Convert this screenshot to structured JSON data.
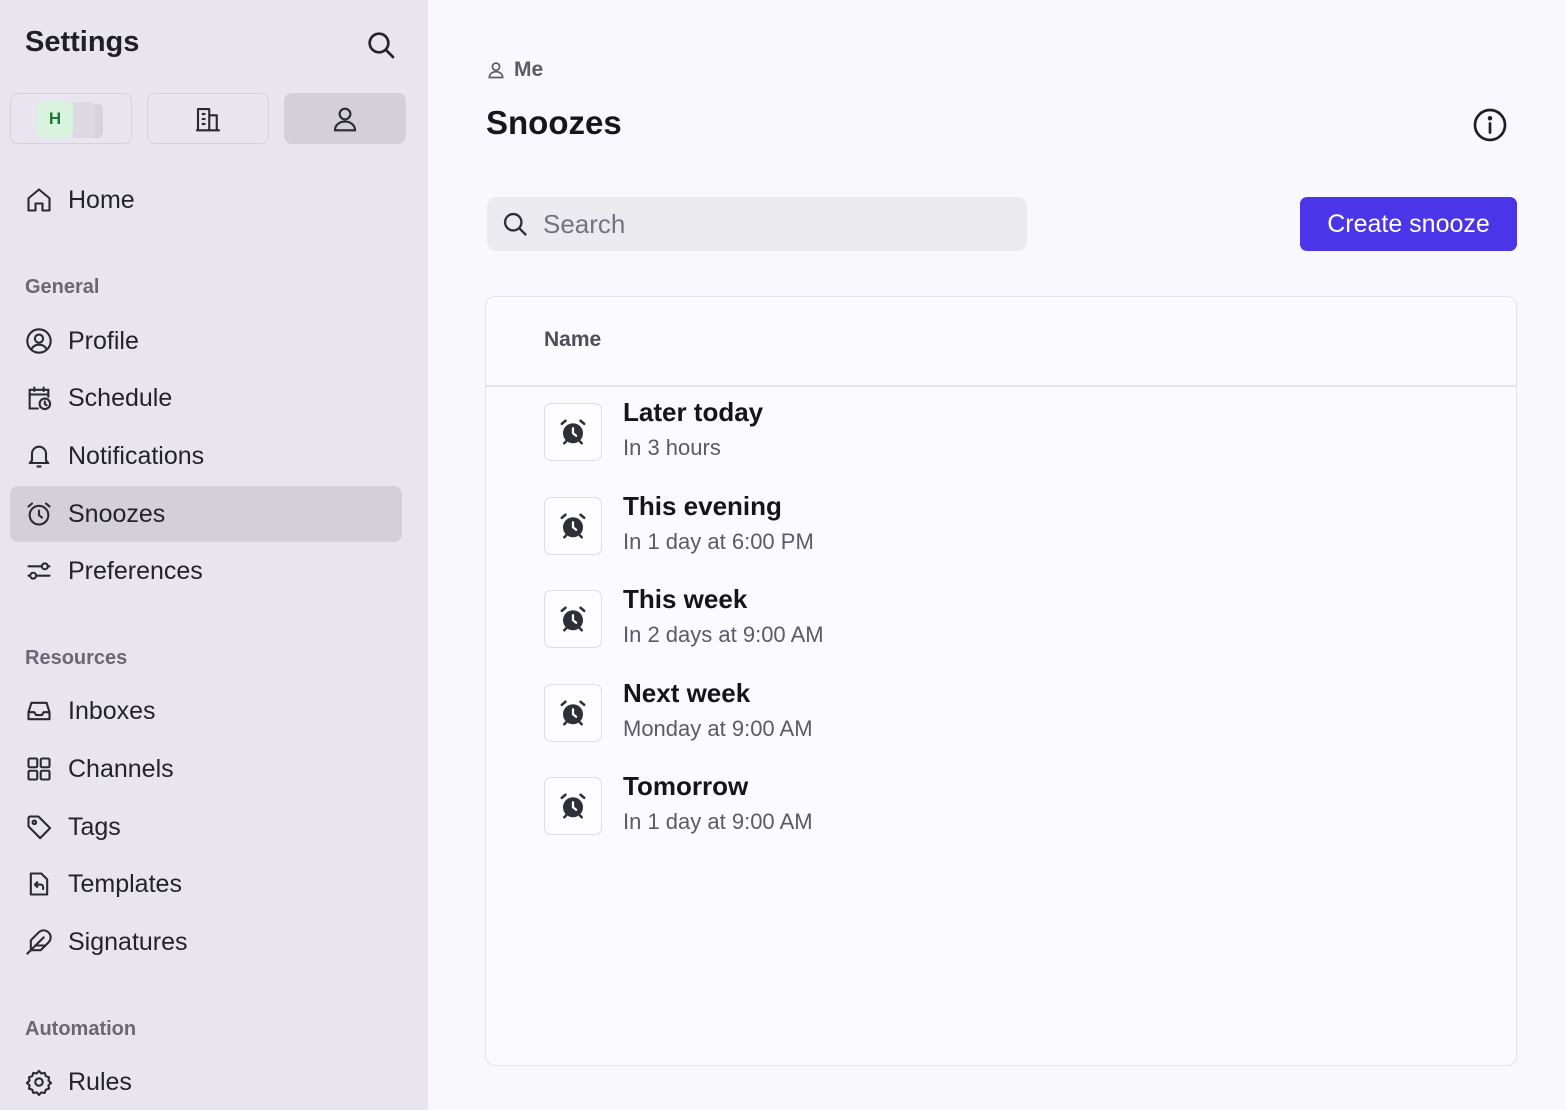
{
  "sidebar": {
    "title": "Settings",
    "workspace_switcher": {
      "team_initial": "H"
    },
    "home_label": "Home",
    "sections": {
      "general": "General",
      "resources": "Resources",
      "automation": "Automation"
    },
    "general_items": [
      {
        "label": "Profile",
        "icon": "user-circle-icon"
      },
      {
        "label": "Schedule",
        "icon": "calendar-clock-icon"
      },
      {
        "label": "Notifications",
        "icon": "bell-icon"
      },
      {
        "label": "Snoozes",
        "icon": "alarm-clock-icon",
        "active": true
      },
      {
        "label": "Preferences",
        "icon": "sliders-icon"
      }
    ],
    "resource_items": [
      {
        "label": "Inboxes",
        "icon": "inbox-icon"
      },
      {
        "label": "Channels",
        "icon": "grid-icon"
      },
      {
        "label": "Tags",
        "icon": "tag-icon"
      },
      {
        "label": "Templates",
        "icon": "template-icon"
      },
      {
        "label": "Signatures",
        "icon": "feather-icon"
      }
    ],
    "automation_items": [
      {
        "label": "Rules",
        "icon": "gear-icon"
      }
    ]
  },
  "main": {
    "breadcrumb": "Me",
    "title": "Snoozes",
    "search": {
      "placeholder": "Search",
      "value": ""
    },
    "create_button": "Create snooze",
    "table": {
      "column_name": "Name",
      "rows": [
        {
          "title": "Later today",
          "subtitle": "In 3 hours"
        },
        {
          "title": "This evening",
          "subtitle": "In 1 day at 6:00 PM"
        },
        {
          "title": "This week",
          "subtitle": "In 2 days at 9:00 AM"
        },
        {
          "title": "Next week",
          "subtitle": "Monday at 9:00 AM"
        },
        {
          "title": "Tomorrow",
          "subtitle": "In 1 day at 9:00 AM"
        }
      ]
    }
  },
  "colors": {
    "accent": "#4a35e8",
    "sidebar_bg": "#e8e5ef",
    "active_item_bg": "#d3d0d9",
    "team_avatar_bg": "#d8f3de"
  }
}
